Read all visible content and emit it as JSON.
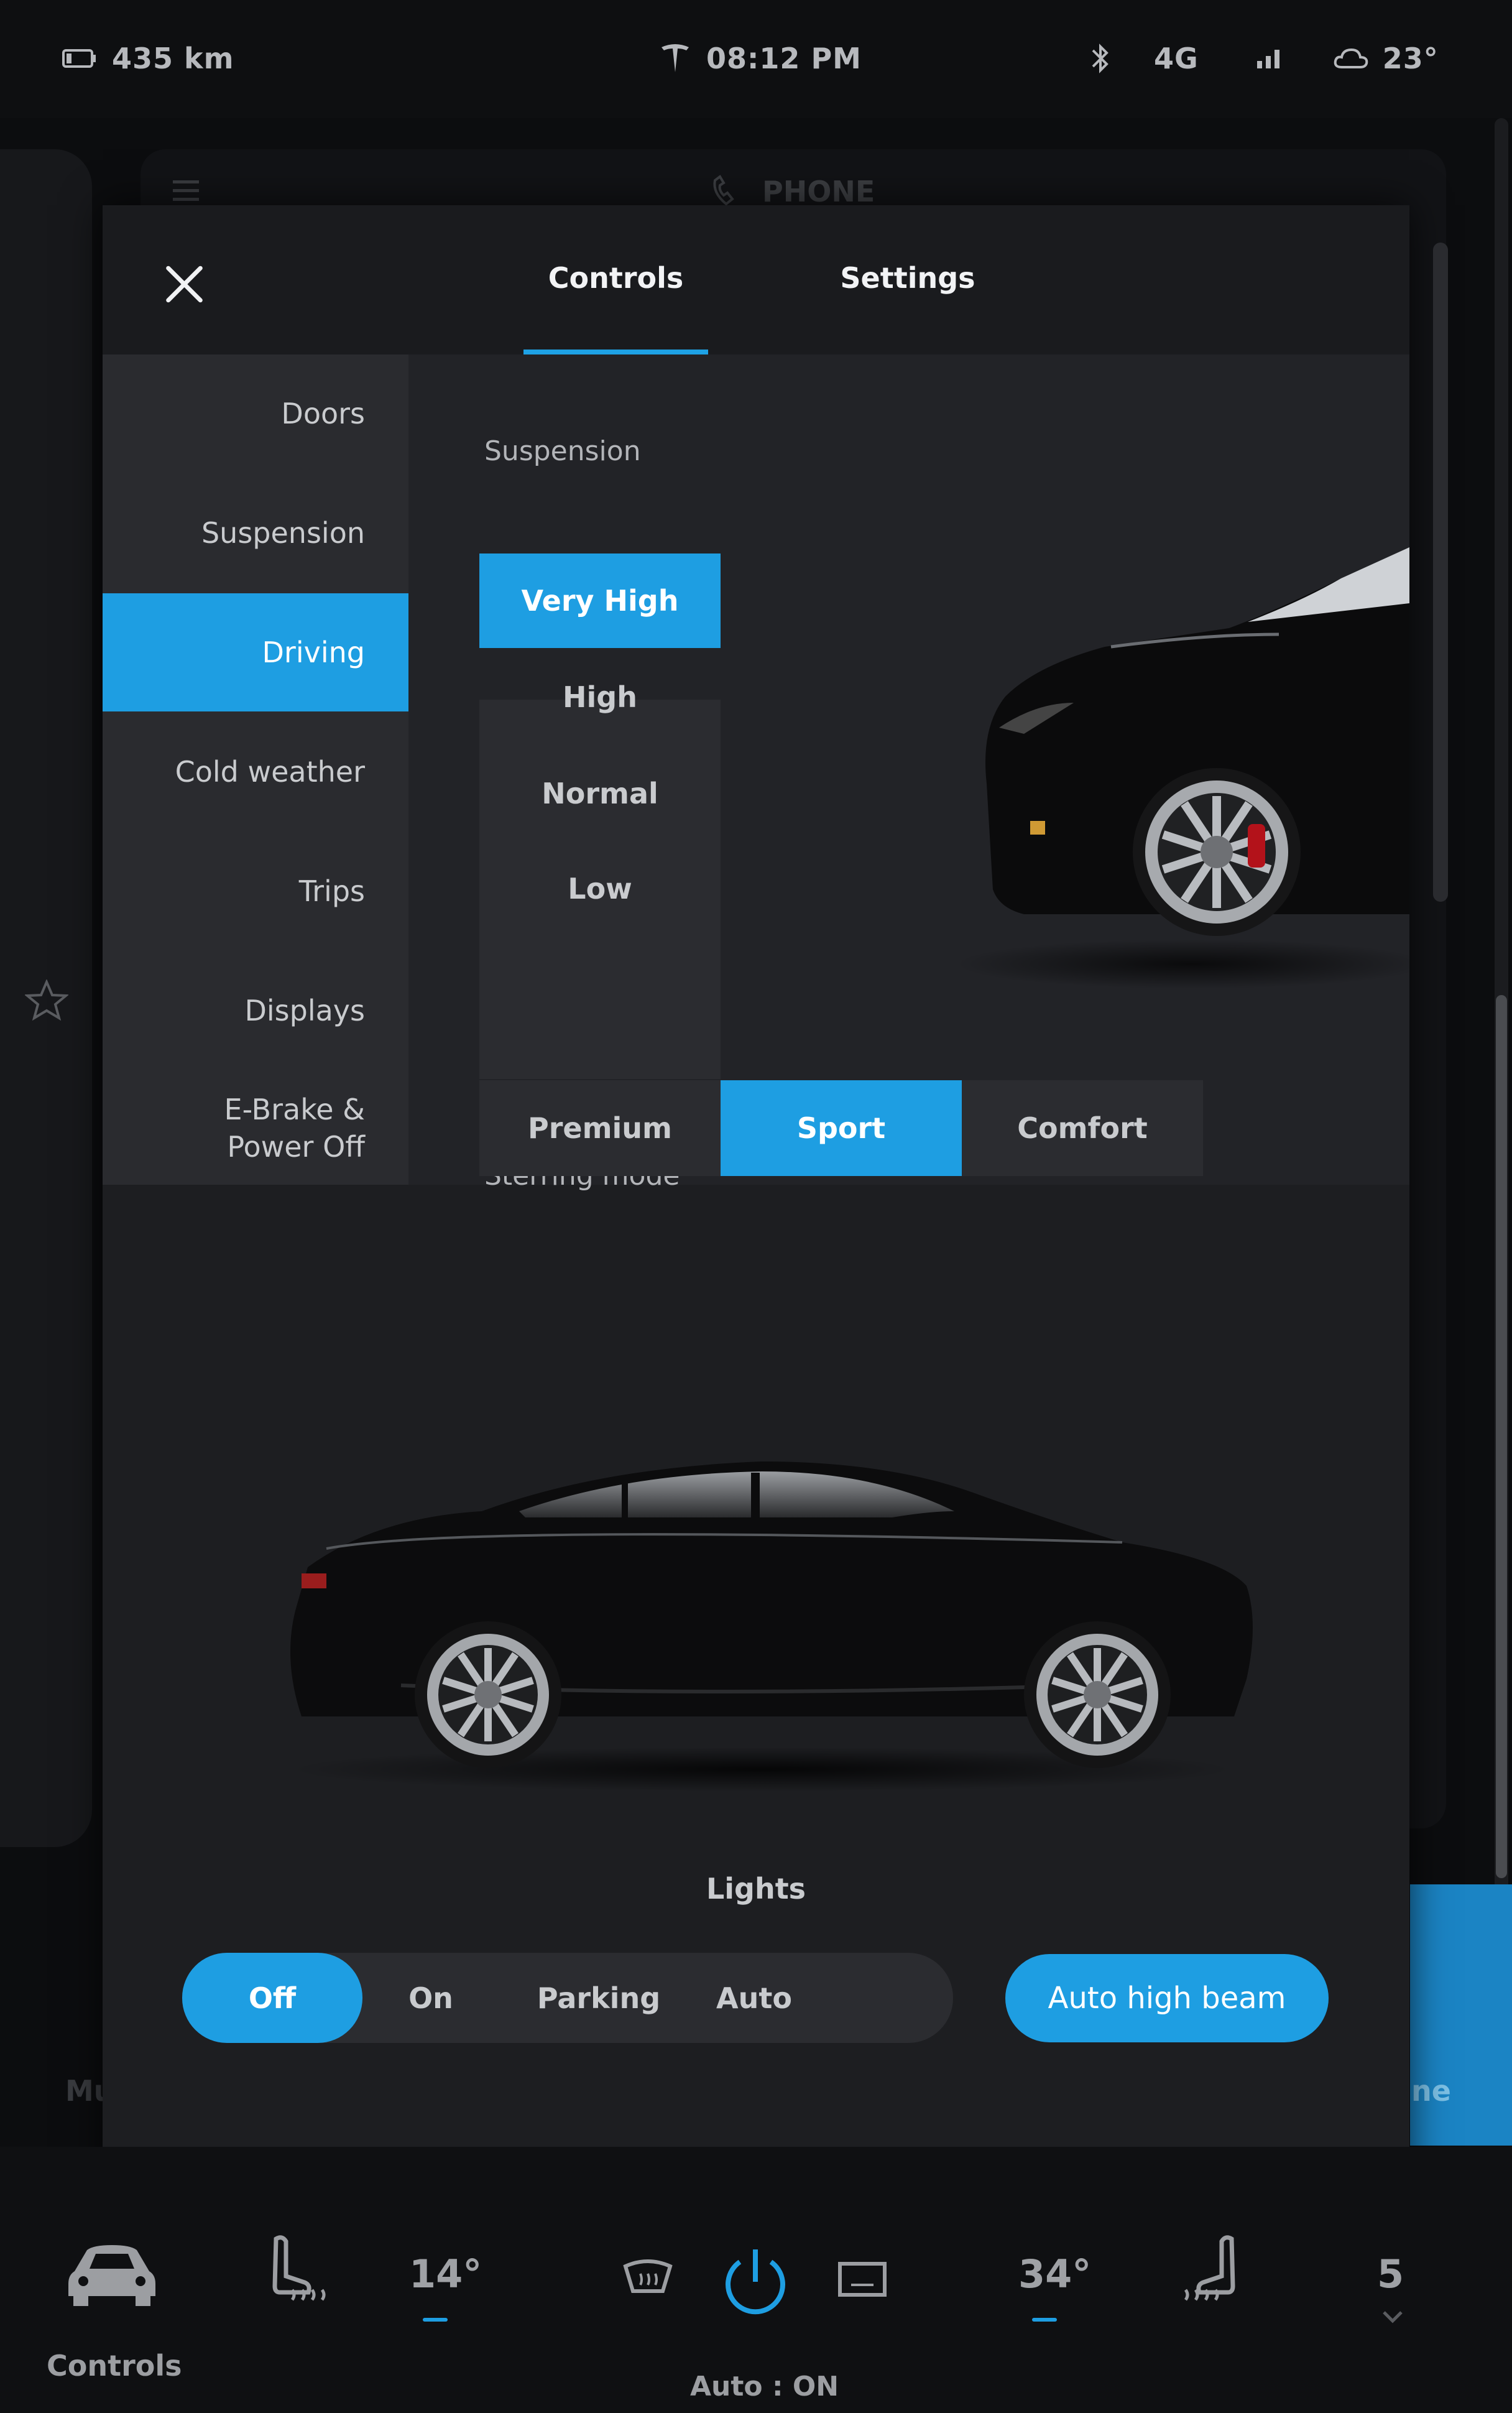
{
  "status_bar": {
    "range": "435 km",
    "time": "08:12 PM",
    "network": "4G",
    "temperature": "23°"
  },
  "background": {
    "phone_label": "PHONE",
    "left_partial": "Mu",
    "right_partial": "ne"
  },
  "modal": {
    "tabs": [
      {
        "label": "Controls",
        "active": true
      },
      {
        "label": "Settings",
        "active": false
      }
    ],
    "sidebar": [
      {
        "label": "Doors",
        "active": false
      },
      {
        "label": "Suspension",
        "active": false
      },
      {
        "label": "Driving",
        "active": true
      },
      {
        "label": "Cold weather",
        "active": false
      },
      {
        "label": "Trips",
        "active": false
      },
      {
        "label": "Displays",
        "active": false
      },
      {
        "label": "E-Brake &\nPower Off",
        "active": false
      }
    ],
    "suspension": {
      "title": "Suspension",
      "options": [
        "Very High",
        "High",
        "Normal",
        "Low"
      ],
      "selected": "Very High"
    },
    "steering": {
      "title": "Sterring mode",
      "options": [
        "Premium",
        "Sport",
        "Comfort"
      ],
      "selected": "Sport"
    },
    "lights": {
      "title": "Lights",
      "options": [
        "Off",
        "On",
        "Parking",
        "Auto"
      ],
      "selected": "Off",
      "auto_high_beam": "Auto high beam"
    }
  },
  "dock": {
    "controls_label": "Controls",
    "left_temp": "14°",
    "right_temp": "34°",
    "climate_status": "Auto : ON",
    "volume": "5"
  },
  "colors": {
    "accent": "#1e9ee2",
    "background": "#1d1e21",
    "sidebar": "#2a2b2f"
  }
}
